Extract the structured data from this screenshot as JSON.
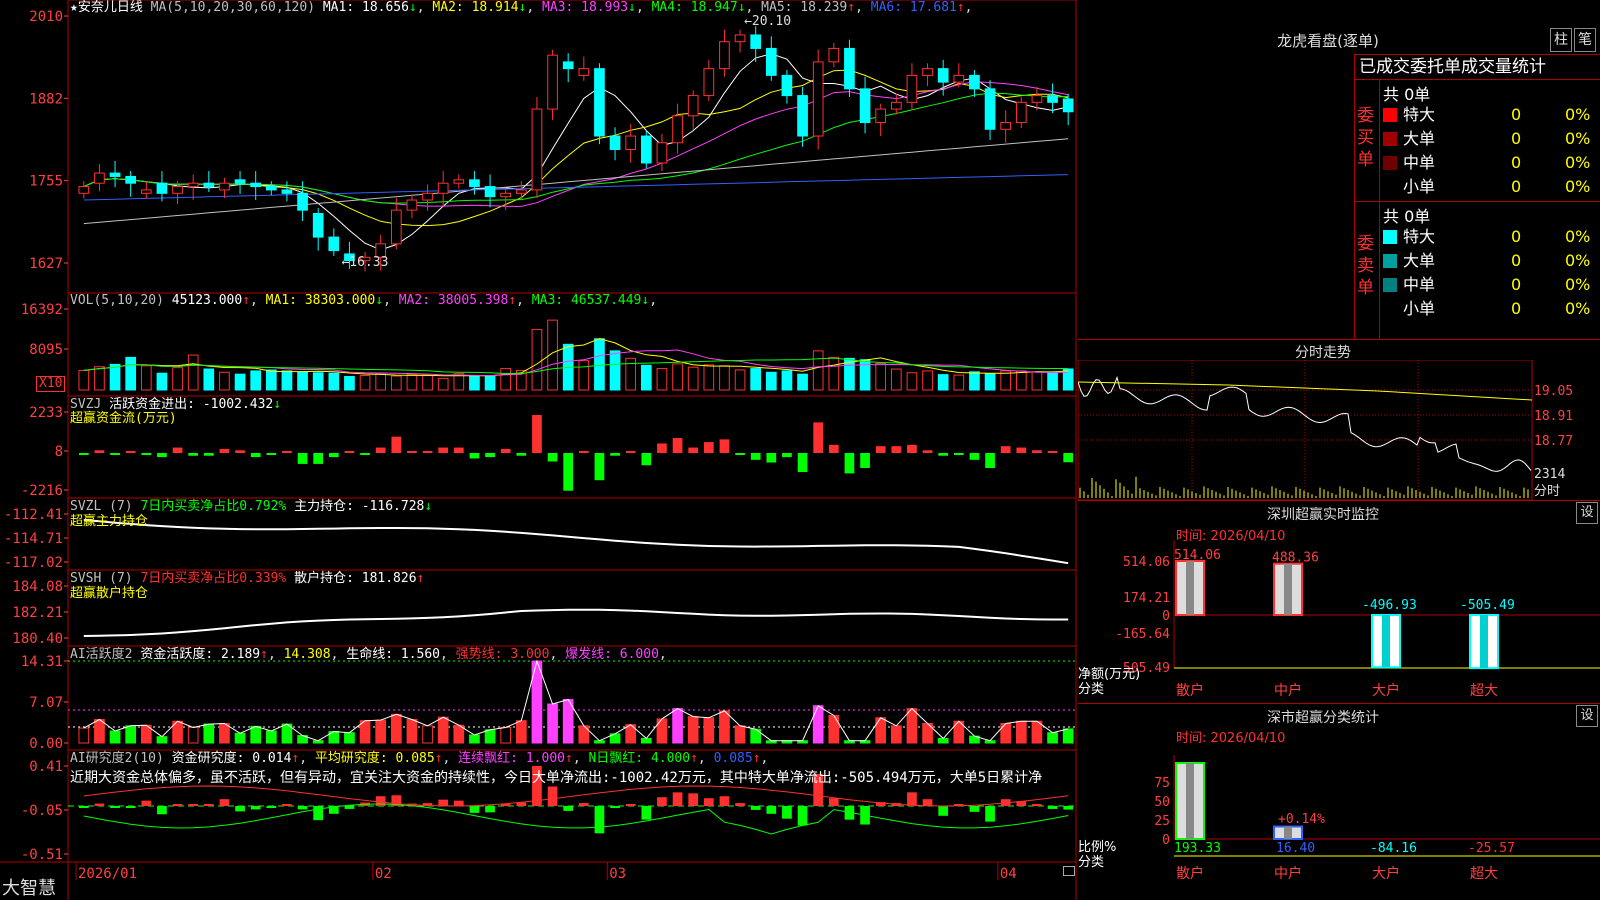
{
  "chart_data": [
    {
      "type": "candlestick",
      "title": "★安奈儿日线",
      "indicator": "MA(5,10,20,30,60,120)",
      "ma": [
        {
          "name": "MA1",
          "value": "18.656",
          "arrow": "↓",
          "color": "#ffffff"
        },
        {
          "name": "MA2",
          "value": "18.914",
          "arrow": "↓",
          "color": "#ffff00"
        },
        {
          "name": "MA3",
          "value": "18.993",
          "arrow": "↓",
          "color": "#ff40ff"
        },
        {
          "name": "MA4",
          "value": "18.947",
          "arrow": "↓",
          "color": "#00ff00"
        },
        {
          "name": "MA5",
          "value": "18.239",
          "arrow": "↑",
          "color": "#c0c0c0"
        },
        {
          "name": "MA6",
          "value": "17.681",
          "arrow": "↑",
          "color": "#3060ff"
        }
      ],
      "yticks": [
        "2010",
        "1882",
        "1755",
        "1627"
      ],
      "ylim": [
        16.0,
        20.2
      ],
      "annotations": [
        "←20.10",
        "←16.33"
      ],
      "closes": [
        17.55,
        17.75,
        17.7,
        17.6,
        17.5,
        17.45,
        17.55,
        17.6,
        17.55,
        17.6,
        17.6,
        17.55,
        17.5,
        17.45,
        17.2,
        16.8,
        16.6,
        16.45,
        16.5,
        16.7,
        17.2,
        17.35,
        17.45,
        17.6,
        17.65,
        17.55,
        17.4,
        17.45,
        17.5,
        18.7,
        19.5,
        19.3,
        19.3,
        18.3,
        18.1,
        18.3,
        17.9,
        18.2,
        18.6,
        18.9,
        19.3,
        19.7,
        19.8,
        19.6,
        19.2,
        18.9,
        18.3,
        19.4,
        19.6,
        19.0,
        18.5,
        18.7,
        18.8,
        19.2,
        19.3,
        19.1,
        19.2,
        19.0,
        18.4,
        18.5,
        18.8,
        18.9,
        18.8,
        18.66
      ],
      "opens": [
        17.45,
        17.6,
        17.75,
        17.7,
        17.45,
        17.6,
        17.45,
        17.55,
        17.6,
        17.5,
        17.65,
        17.6,
        17.55,
        17.5,
        17.45,
        17.15,
        16.8,
        16.55,
        16.45,
        16.5,
        16.7,
        17.2,
        17.35,
        17.45,
        17.6,
        17.65,
        17.55,
        17.4,
        17.45,
        17.5,
        18.7,
        19.4,
        19.2,
        19.3,
        18.3,
        18.1,
        18.3,
        17.9,
        18.2,
        18.6,
        18.9,
        19.3,
        19.7,
        19.8,
        19.6,
        19.2,
        18.9,
        18.3,
        19.4,
        19.6,
        19.0,
        18.5,
        18.7,
        18.8,
        19.2,
        19.3,
        19.1,
        19.2,
        19.0,
        18.4,
        18.5,
        18.8,
        18.9,
        18.85
      ],
      "vol": [
        4200,
        5000,
        5500,
        7000,
        5200,
        3600,
        4800,
        7500,
        4500,
        3800,
        3400,
        4100,
        4300,
        4100,
        3900,
        3700,
        3600,
        2900,
        3100,
        3400,
        3000,
        3300,
        3100,
        2500,
        3500,
        3000,
        3100,
        4600,
        4200,
        13000,
        15000,
        9800,
        6300,
        11000,
        8400,
        6800,
        5300,
        4600,
        5600,
        4900,
        5400,
        5200,
        4300,
        4600,
        3800,
        4100,
        3400,
        8400,
        7000,
        6800,
        6500,
        5700,
        4500,
        3700,
        4100,
        3300,
        3200,
        3900,
        3500,
        4100,
        4100,
        3900,
        3800,
        4512
      ],
      "vol_label": "VOL(5,10,20)",
      "vol_values": [
        {
          "name": "",
          "value": "45123.000",
          "arrow": "↑",
          "color": "#ffffff"
        },
        {
          "name": "MA1",
          "value": "38303.000",
          "arrow": "↓",
          "color": "#ffff00"
        },
        {
          "name": "MA2",
          "value": "38005.398",
          "arrow": "↑",
          "color": "#ff40ff"
        },
        {
          "name": "MA3",
          "value": "46537.449",
          "arrow": "↓",
          "color": "#00ff00"
        }
      ],
      "vol_yticks": [
        "16392",
        "8095"
      ],
      "vol_unit": "X10",
      "x_ticks": [
        "2026/01",
        "02",
        "03",
        "04"
      ]
    }
  ],
  "indicators": {
    "svzj": {
      "label": "SVZJ",
      "name": "活跃资金进出",
      "value": "-1002.432",
      "arrow": "↓",
      "sub": "超赢资金流(万元)",
      "yticks": [
        "2233",
        "8",
        "-2216"
      ]
    },
    "svzl": {
      "label": "SVZL (7)",
      "ratio_label": "7日内买卖净占比0.792%",
      "name": "主力持仓",
      "value": "-116.728",
      "arrow": "↓",
      "sub": "超赢主力持仓",
      "yticks": [
        "-112.41",
        "-114.71",
        "-117.02"
      ]
    },
    "svsh": {
      "label": "SVSH (7)",
      "ratio_label": "7日内买卖净占比0.339%",
      "name": "散户持仓",
      "value": "181.826",
      "arrow": "↑",
      "sub": "超赢散户持仓",
      "yticks": [
        "184.08",
        "182.21",
        "180.40"
      ]
    },
    "ai_active": {
      "label": "AI活跃度2",
      "items": [
        {
          "text": "资金活跃度: 2.189",
          "arrow": "↑",
          "color": "#ffffff"
        },
        {
          "text": "14.308",
          "arrow": "",
          "color": "#ffff00"
        },
        {
          "text": "生命线: 1.560",
          "arrow": "",
          "color": "#ffffff"
        },
        {
          "text": "强势线: 3.000",
          "arrow": "",
          "color": "#ff3030"
        },
        {
          "text": "爆发线: 6.000",
          "arrow": "",
          "color": "#ff40ff"
        }
      ],
      "yticks": [
        "14.31",
        "7.07",
        "0.00"
      ]
    },
    "ai_research": {
      "label": "AI研究度2(10)",
      "items": [
        {
          "text": "资金研究度: 0.014",
          "arrow": "↑",
          "color": "#ffffff"
        },
        {
          "text": "平均研究度: 0.085",
          "arrow": "↑",
          "color": "#ffff00"
        },
        {
          "text": "连续飘红: 1.000",
          "arrow": "↑",
          "color": "#ff40ff"
        },
        {
          "text": "N日飘红: 4.000",
          "arrow": "↑",
          "color": "#00ff00"
        },
        {
          "text": "0.085",
          "arrow": "↑",
          "color": "#3060ff"
        }
      ],
      "summary": "近期大资金总体偏多，虽不活跃，但有异动，宜关注大资金的持续性，今日大单净流出:-1002.42万元，其中特大单净流出:-505.494万元，大单5日累计净",
      "yticks": [
        "0.41",
        "-0.05",
        "-0.51"
      ]
    }
  },
  "footer": {
    "brand": "大智慧"
  },
  "right": {
    "title": "龙虎看盘(逐单)",
    "btn_zhu": "柱",
    "btn_bi": "笔",
    "stats_header": "已成交委托单成交量统计",
    "buy": {
      "side": "委买单",
      "total": "共 0单",
      "rows": [
        {
          "name": "特大",
          "count": "0",
          "pct": "0%",
          "color": "#ff0000"
        },
        {
          "name": "大单",
          "count": "0",
          "pct": "0%",
          "color": "#a00000"
        },
        {
          "name": "中单",
          "count": "0",
          "pct": "0%",
          "color": "#700000"
        },
        {
          "name": "小单",
          "count": "0",
          "pct": "0%",
          "color": "#000000"
        }
      ]
    },
    "sell": {
      "side": "委卖单",
      "total": "共 0单",
      "rows": [
        {
          "name": "特大",
          "count": "0",
          "pct": "0%",
          "color": "#00ffff"
        },
        {
          "name": "大单",
          "count": "0",
          "pct": "0%",
          "color": "#00a0a0"
        },
        {
          "name": "中单",
          "count": "0",
          "pct": "0%",
          "color": "#008080"
        },
        {
          "name": "小单",
          "count": "0",
          "pct": "0%",
          "color": "#000000"
        }
      ]
    },
    "intraday": {
      "title": "分时走势",
      "yticks": [
        "19.05",
        "18.91",
        "18.77"
      ],
      "vol_tick": "2314",
      "vol_unit": "分时"
    },
    "monitor": {
      "title": "深圳超赢实时监控",
      "time": "时间: 2026/04/10",
      "btn": "设",
      "yticks": [
        "514.06",
        "174.21",
        "0",
        "-165.64",
        "-505.49"
      ],
      "bars": [
        {
          "cat": "散户",
          "value": 514.06,
          "label": "514.06"
        },
        {
          "cat": "中户",
          "value": 488.36,
          "label": "488.36"
        },
        {
          "cat": "大户",
          "value": -496.93,
          "label": "-496.93"
        },
        {
          "cat": "超大",
          "value": -505.49,
          "label": "-505.49"
        }
      ],
      "ylabel1": "净额(万元)",
      "ylabel2": "分类"
    },
    "classify": {
      "title": "深市超赢分类统计",
      "time": "时间: 2026/04/10",
      "btn": "设",
      "yticks": [
        "75",
        "50",
        "25",
        "0"
      ],
      "bars": [
        {
          "cat": "散户",
          "value": 193.33,
          "label": "193.33",
          "color": "#00ff00"
        },
        {
          "cat": "中户",
          "value": 16.4,
          "label": "16.40",
          "color": "#3060ff"
        },
        {
          "cat": "大户",
          "value": -84.16,
          "label": "-84.16",
          "color": "#00ffff"
        },
        {
          "cat": "超大",
          "value": -25.57,
          "label": "-25.57",
          "color": "#ff3030"
        }
      ],
      "bar_note": "+0.14%",
      "ylabel1": "比例%",
      "ylabel2": "分类"
    }
  },
  "colors": {
    "up": "#ff3030",
    "down": "#00ffff",
    "border": "#b00000",
    "up_vol": "#ff3030",
    "down_vol": "#00ffff"
  }
}
